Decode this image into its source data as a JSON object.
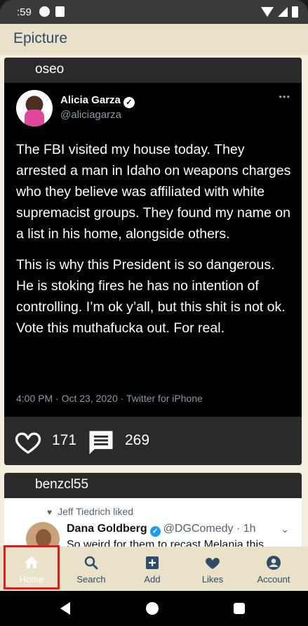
{
  "status_bar": {
    "time": ":59"
  },
  "app": {
    "title": "Epicture"
  },
  "posts": [
    {
      "username": "oseo",
      "tweet": {
        "author_name": "Alicia Garza",
        "author_handle": "@aliciagarza",
        "paragraphs": [
          "The FBI visited my house today. They arrested a man in Idaho on weapons charges who they believe was affiliated with white supremacist groups. They found my name on a list in his home, alongside others.",
          "This is why this President is so dangerous. He is stoking fires he has no intention of controlling. I’m ok y’all, but this shit is not ok. Vote this muthafucka out. For real."
        ],
        "meta": "4:00 PM · Oct 23, 2020 · Twitter for iPhone"
      },
      "likes": "171",
      "comments": "269"
    },
    {
      "username": "benzcl55",
      "embed": {
        "liked_by": "Jeff Tiedrich liked",
        "author_name": "Dana Goldberg",
        "author_handle": "@DGComedy · 1h",
        "text": "So weird for them to recast Melania this"
      }
    }
  ],
  "bottom_nav": {
    "items": [
      {
        "label": "Home",
        "icon": "home-icon",
        "active": true
      },
      {
        "label": "Search",
        "icon": "search-icon"
      },
      {
        "label": "Add",
        "icon": "add-box-icon"
      },
      {
        "label": "Likes",
        "icon": "heart-icon"
      },
      {
        "label": "Account",
        "icon": "account-circle-icon"
      }
    ]
  },
  "colors": {
    "app_bar": "#e9e2c9",
    "accent": "#2e4b6a",
    "highlight": "#e11b1b"
  }
}
